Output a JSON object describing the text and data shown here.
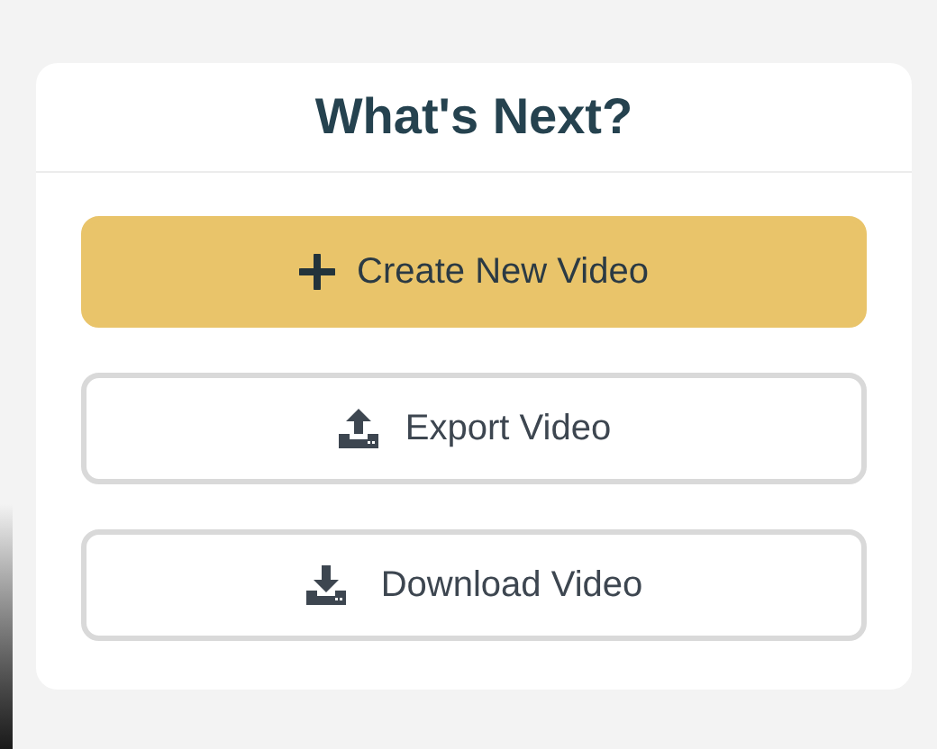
{
  "card": {
    "title": "What's Next?",
    "buttons": [
      {
        "label": "Create New Video",
        "kind": "create"
      },
      {
        "label": "Export Video",
        "kind": "export"
      },
      {
        "label": "Download Video",
        "kind": "download"
      }
    ]
  }
}
